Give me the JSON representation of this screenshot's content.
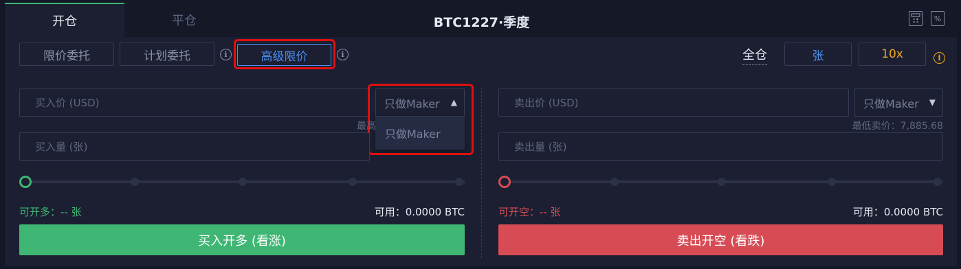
{
  "header": {
    "tab_open": "开仓",
    "tab_close": "平仓",
    "title": "BTC1227·季度",
    "calculator_icon": "calculator-icon",
    "percent_icon": "percent-icon"
  },
  "order_types": [
    "限价委托",
    "计划委托",
    "高级限价"
  ],
  "settings": {
    "margin_mode": "全仓",
    "unit": "张",
    "leverage": "10x"
  },
  "buy": {
    "price_placeholder": "买入价 (USD)",
    "maker_select": "只做Maker",
    "max_hint": "最高",
    "amount_placeholder": "买入量 (张)",
    "open_label": "可开多：-- 张",
    "available": "可用：0.0000 BTC",
    "button": "买入开多 (看涨)"
  },
  "sell": {
    "price_placeholder": "卖出价 (USD)",
    "maker_select": "只做Maker",
    "min_hint": "最低卖价：7,885.68",
    "amount_placeholder": "卖出量 (张)",
    "open_label": "可开空：-- 张",
    "available": "可用：0.0000 BTC",
    "button": "卖出开空 (看跌)"
  },
  "dropdown": {
    "option": "只做Maker"
  },
  "colors": {
    "buy": "#3fb673",
    "sell": "#d74b54",
    "accent": "#4a8ef0",
    "leverage": "#f3a81b"
  }
}
